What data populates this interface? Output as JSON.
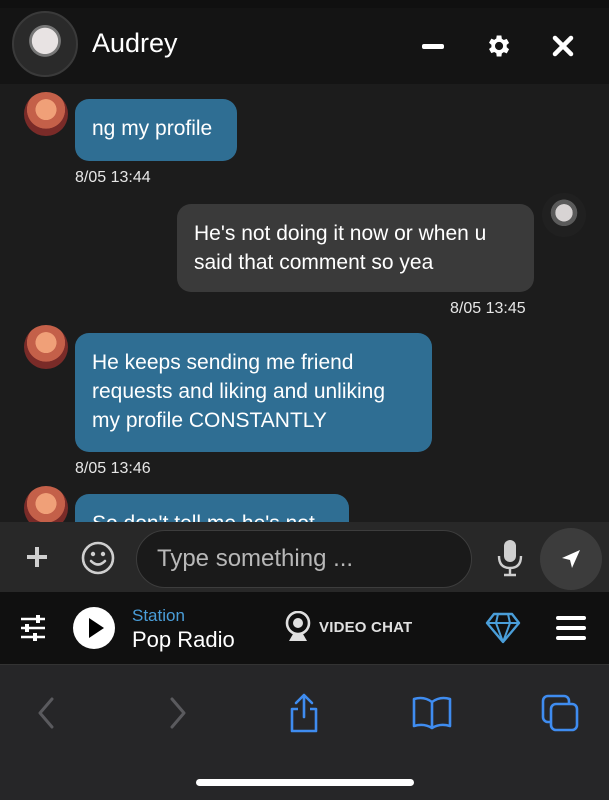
{
  "header": {
    "contact_name": "Audrey",
    "icons": [
      "minimize-icon",
      "gear-icon",
      "close-icon"
    ]
  },
  "messages": [
    {
      "direction": "in",
      "text": "ng my profile",
      "timestamp": "8/05 13:44"
    },
    {
      "direction": "out",
      "text": "He's not doing it now or when u said that comment so yea",
      "timestamp": "8/05 13:45"
    },
    {
      "direction": "in",
      "text": "He keeps sending me friend requests and liking and unliking my profile CONSTANTLY",
      "timestamp": "8/05 13:46"
    },
    {
      "direction": "in",
      "text": "So don't tell me he's not",
      "timestamp": ""
    }
  ],
  "input": {
    "placeholder": "Type something ...",
    "value": "",
    "icons": [
      "plus-icon",
      "emoji-icon",
      "microphone-icon",
      "send-icon"
    ]
  },
  "radio": {
    "station_label": "Station",
    "station_name": "Pop Radio",
    "video_chat_label": "VIDEO CHAT",
    "icons": [
      "equalizer-icon",
      "play-icon",
      "webcam-icon",
      "diamond-icon",
      "menu-icon"
    ]
  },
  "browser": {
    "icons": [
      "back-icon",
      "forward-icon",
      "share-icon",
      "bookmarks-icon",
      "tabs-icon"
    ]
  },
  "colors": {
    "incoming_bubble": "#2f6e93",
    "outgoing_bubble": "#3a3a3a",
    "accent_blue": "#4a9ed9",
    "background": "#1c1c1c"
  }
}
